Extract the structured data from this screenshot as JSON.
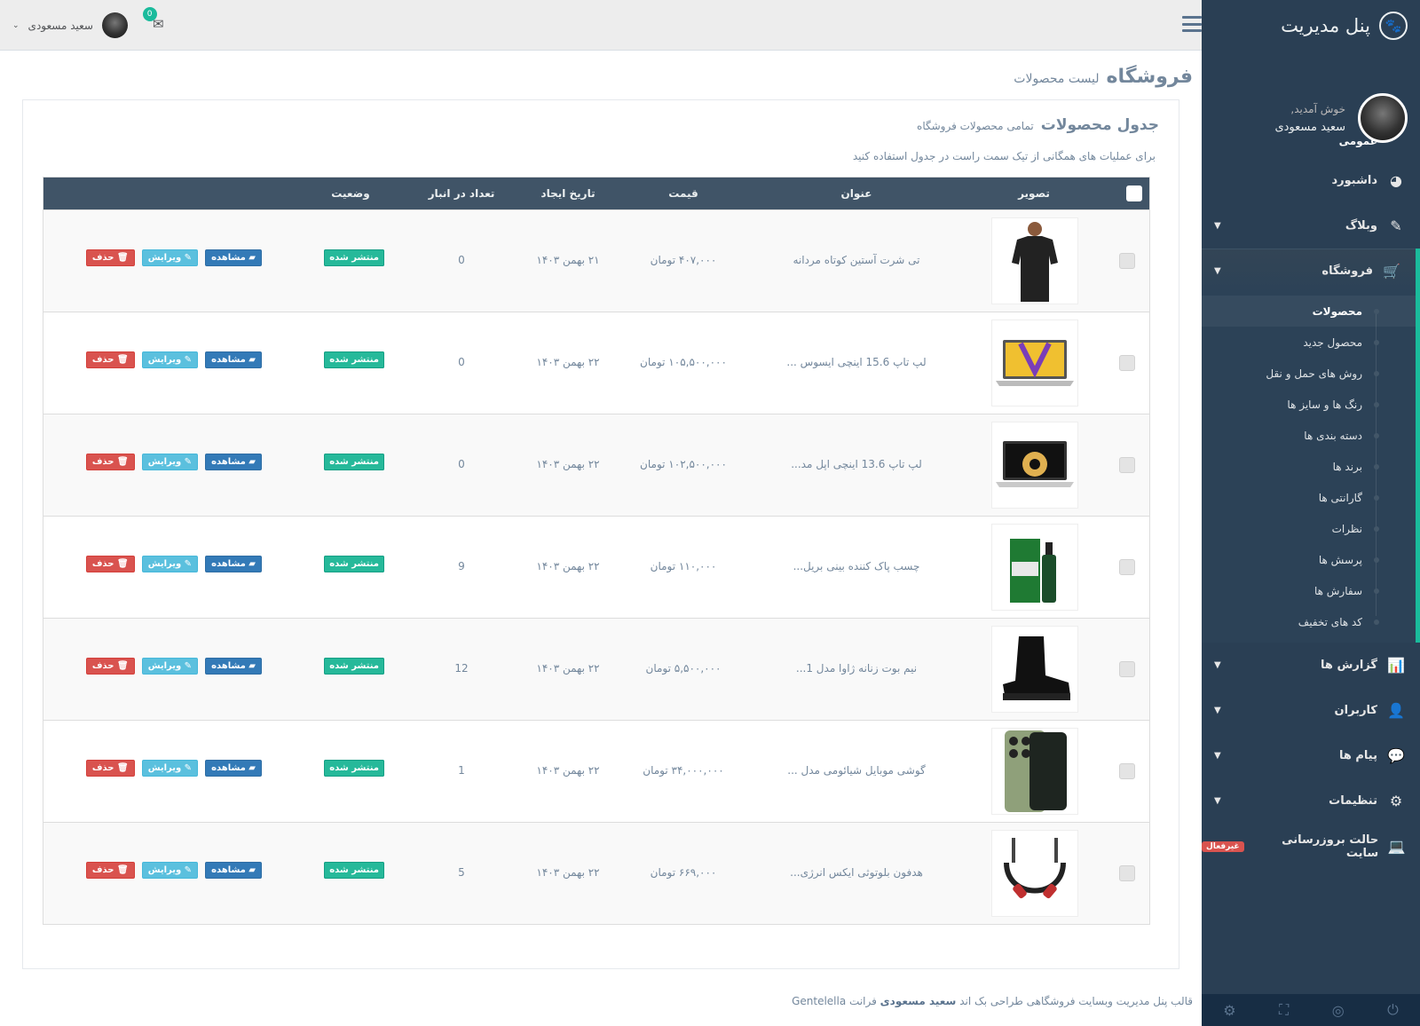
{
  "brand": {
    "title": "پنل مدیریت",
    "logo_icon": "paw-icon"
  },
  "profile": {
    "welcome": "خوش آمدید,",
    "name": "سعید مسعودی"
  },
  "sidebar": {
    "section": "عمومی",
    "items": [
      {
        "label": "داشبورد",
        "icon": "dashboard-icon"
      },
      {
        "label": "وبلاگ",
        "icon": "edit-icon"
      },
      {
        "label": "فروشگاه",
        "icon": "cart-icon"
      },
      {
        "label": "گزارش ها",
        "icon": "chart-icon"
      },
      {
        "label": "کاربران",
        "icon": "user-icon"
      },
      {
        "label": "پیام ها",
        "icon": "comments-icon"
      },
      {
        "label": "تنظیمات",
        "icon": "gear-icon"
      },
      {
        "label": "حالت بروزرسانی سایت",
        "icon": "laptop-icon",
        "badge": "غیرفعال"
      }
    ],
    "shop_sub": [
      "محصولات",
      "محصول جدید",
      "روش های حمل و نقل",
      "رنگ ها و سایز ها",
      "دسته بندی ها",
      "برند ها",
      "گارانتی ها",
      "نظرات",
      "پرسش ها",
      "سفارش ها",
      "کد های تخفیف"
    ]
  },
  "topnav": {
    "user_name": "سعید مسعودی",
    "mail_count": "0"
  },
  "page": {
    "title": "فروشگاه",
    "subtitle": "لیست محصولات"
  },
  "panel": {
    "title": "جدول محصولات",
    "subtitle": "تمامی محصولات فروشگاه",
    "hint": "برای عملیات های همگانی از تیک سمت راست در جدول استفاده کنید"
  },
  "table": {
    "headers": {
      "image": "تصویر",
      "title": "عنوان",
      "price": "قیمت",
      "date": "تاریخ ایجاد",
      "stock": "تعداد در انبار",
      "status": "وضعیت"
    },
    "buttons": {
      "view": "مشاهده",
      "edit": "ویرایش",
      "delete": "حذف"
    },
    "rows": [
      {
        "title": "تی شرت آستین کوتاه مردانه",
        "price": "۴۰۷,۰۰۰ تومان",
        "date": "۲۱ بهمن ۱۴۰۳",
        "stock": "0",
        "status": "منتشر شده",
        "thumb": "tshirt"
      },
      {
        "title": "لپ تاپ 15.6 اینچی ایسوس ...",
        "price": "۱۰۵,۵۰۰,۰۰۰ تومان",
        "date": "۲۲ بهمن ۱۴۰۳",
        "stock": "0",
        "status": "منتشر شده",
        "thumb": "laptop-asus"
      },
      {
        "title": "لپ تاپ 13.6 اینچی اپل مد...",
        "price": "۱۰۲,۵۰۰,۰۰۰ تومان",
        "date": "۲۲ بهمن ۱۴۰۳",
        "stock": "0",
        "status": "منتشر شده",
        "thumb": "laptop-apple"
      },
      {
        "title": "چسب پاک کننده بینی بریل...",
        "price": "۱۱۰,۰۰۰ تومان",
        "date": "۲۲ بهمن ۱۴۰۳",
        "stock": "9",
        "status": "منتشر شده",
        "thumb": "bottle"
      },
      {
        "title": "نیم بوت زنانه ژاوا مدل 1...",
        "price": "۵,۵۰۰,۰۰۰ تومان",
        "date": "۲۲ بهمن ۱۴۰۳",
        "stock": "12",
        "status": "منتشر شده",
        "thumb": "boot"
      },
      {
        "title": "گوشی موبایل شیائومی مدل ...",
        "price": "۳۴,۰۰۰,۰۰۰ تومان",
        "date": "۲۲ بهمن ۱۴۰۳",
        "stock": "1",
        "status": "منتشر شده",
        "thumb": "phone"
      },
      {
        "title": "هدفون بلوتوثی ایکس انرژی...",
        "price": "۶۶۹,۰۰۰ تومان",
        "date": "۲۲ بهمن ۱۴۰۳",
        "stock": "5",
        "status": "منتشر شده",
        "thumb": "headphone"
      }
    ]
  },
  "footer": {
    "before": "قالب پنل مدیریت وبسایت فروشگاهی طراحی بک اند",
    "author": "سعید مسعودی",
    "after": "فرانت Gentelella"
  },
  "colors": {
    "sidebar": "#2a3f54",
    "accent": "#1abb9c",
    "header": "#405467"
  }
}
